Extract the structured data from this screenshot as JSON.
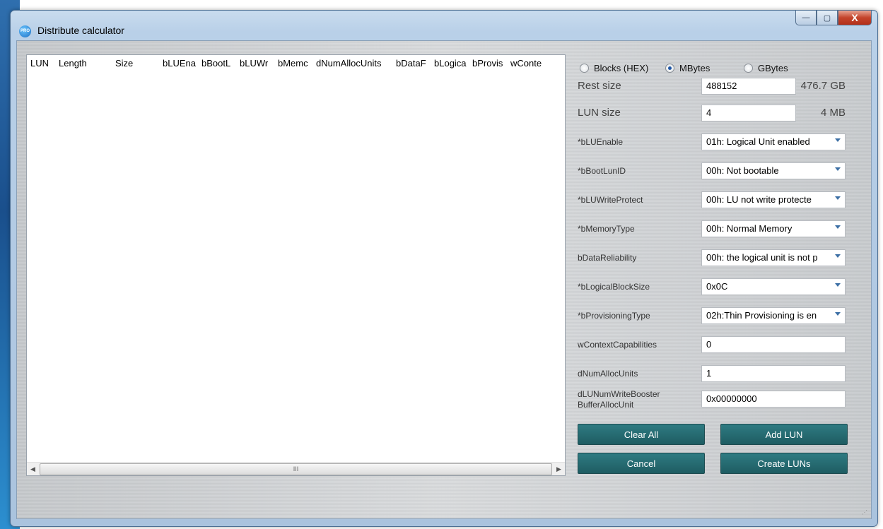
{
  "window": {
    "title": "Distribute calculator",
    "icon_text": "PRO",
    "controls": {
      "minimize": "—",
      "maximize": "▢",
      "close": "X"
    }
  },
  "list": {
    "columns": [
      "LUN",
      "Length",
      "Size",
      "bLUEna",
      "bBootL",
      "bLUWr",
      "bMemc",
      "dNumAllocUnits",
      "bDataF",
      "bLogica",
      "bProvis",
      "wConte"
    ],
    "scroll_thumb": "III"
  },
  "units": {
    "options": [
      "Blocks (HEX)",
      "MBytes",
      "GBytes"
    ],
    "selected": "MBytes"
  },
  "rest_size": {
    "label": "Rest size",
    "value": "488152",
    "human": "476.7 GB"
  },
  "lun_size": {
    "label": "LUN size",
    "value": "4",
    "human": "4 MB"
  },
  "params": [
    {
      "label": "*bLUEnable",
      "value": "01h: Logical Unit enabled",
      "type": "combo"
    },
    {
      "label": "*bBootLunID",
      "value": "00h: Not bootable",
      "type": "combo"
    },
    {
      "label": "*bLUWriteProtect",
      "value": "00h: LU not write protecte",
      "type": "combo"
    },
    {
      "label": "*bMemoryType",
      "value": "00h: Normal Memory",
      "type": "combo"
    },
    {
      "label": "bDataReliability",
      "value": "00h: the logical unit is not p",
      "type": "combo"
    },
    {
      "label": "*bLogicalBlockSize",
      "value": "0x0C",
      "type": "combo"
    },
    {
      "label": "*bProvisioningType",
      "value": "02h:Thin Provisioning is en",
      "type": "combo"
    },
    {
      "label": "wContextCapabilities",
      "value": "0",
      "type": "text"
    },
    {
      "label": "dNumAllocUnits",
      "value": "1",
      "type": "text"
    },
    {
      "label_line1": "dLUNumWriteBooster",
      "label_line2": "BufferAllocUnit",
      "value": "0x00000000",
      "type": "text"
    }
  ],
  "buttons": {
    "clear_all": "Clear All",
    "add_lun": "Add LUN",
    "cancel": "Cancel",
    "create_luns": "Create LUNs"
  }
}
